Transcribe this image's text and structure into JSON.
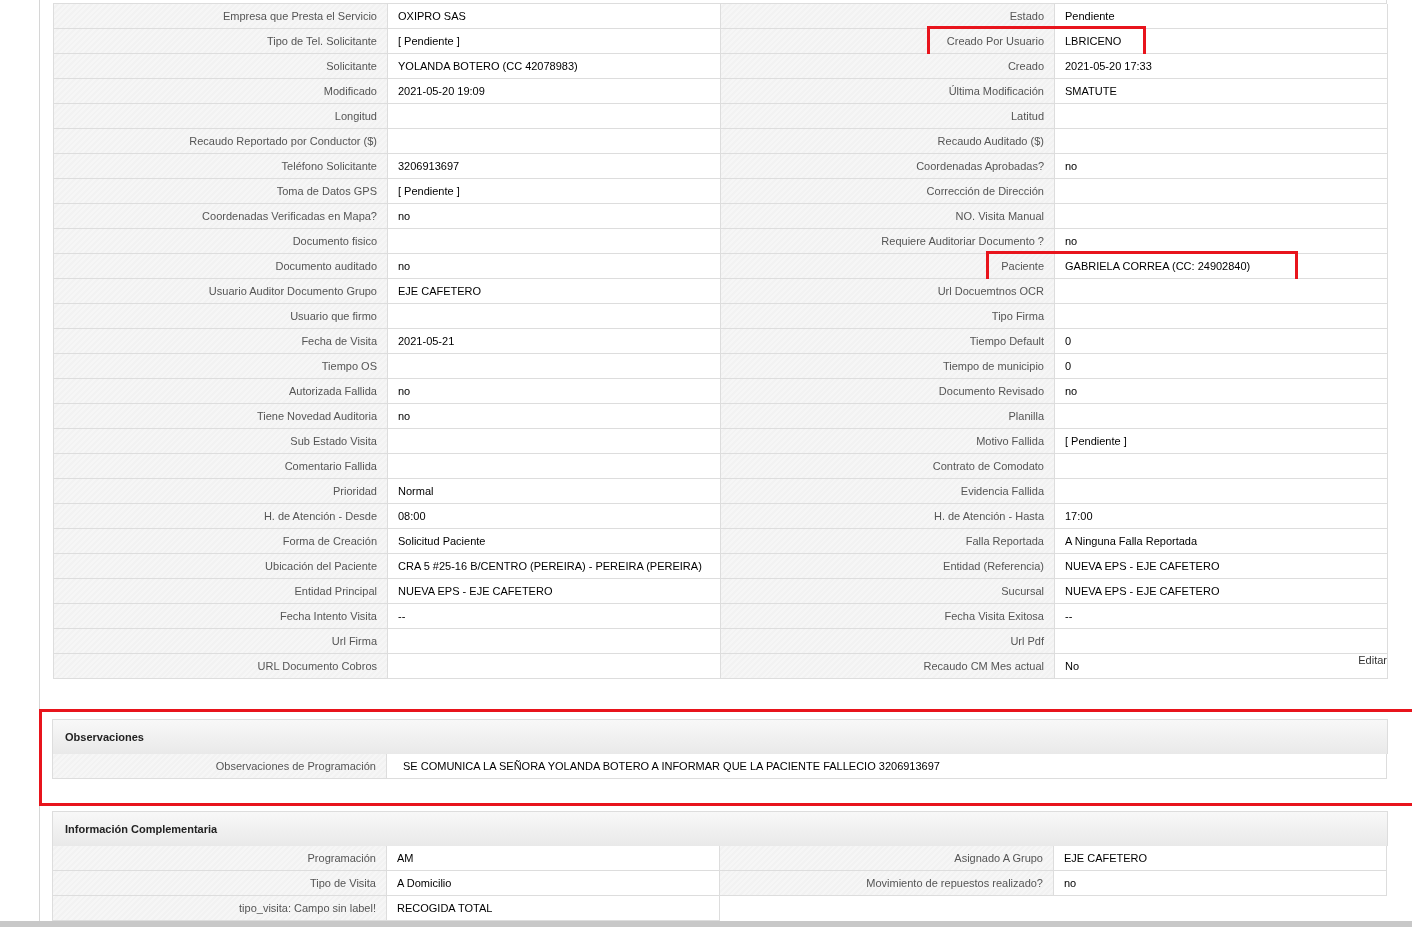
{
  "details": {
    "edit_link": "Editar",
    "rows": [
      {
        "left": {
          "label": "Empresa que Presta el Servicio",
          "value": "OXIPRO SAS"
        },
        "right": {
          "label": "Estado",
          "value": "Pendiente",
          "highlighted": false
        }
      },
      {
        "left": {
          "label": "Tipo de Tel. Solicitante",
          "value": "[ Pendiente ]"
        },
        "right": {
          "label": "Creado Por Usuario",
          "value": "LBRICENO",
          "highlighted": true
        }
      },
      {
        "left": {
          "label": "Solicitante",
          "value": "YOLANDA BOTERO (CC 42078983)"
        },
        "right": {
          "label": "Creado",
          "value": "2021-05-20 17:33",
          "highlighted": false
        }
      },
      {
        "left": {
          "label": "Modificado",
          "value": "2021-05-20 19:09"
        },
        "right": {
          "label": "Última Modificación",
          "value": "SMATUTE",
          "highlighted": false
        }
      },
      {
        "left": {
          "label": "Longitud"
        },
        "right": {
          "label": "Latitud",
          "highlighted": false
        }
      },
      {
        "left": {
          "label": "Recaudo Reportado por Conductor ($)"
        },
        "right": {
          "label": "Recaudo Auditado ($)",
          "highlighted": false
        }
      },
      {
        "left": {
          "label": "Teléfono Solicitante",
          "value": "3206913697"
        },
        "right": {
          "label": "Coordenadas Aprobadas?",
          "value": "no",
          "highlighted": false
        }
      },
      {
        "left": {
          "label": "Toma de Datos GPS",
          "value": "[ Pendiente ]"
        },
        "right": {
          "label": "Corrección de Dirección",
          "highlighted": false
        }
      },
      {
        "left": {
          "label": "Coordenadas Verificadas en Mapa?",
          "value": "no"
        },
        "right": {
          "label": "NO. Visita Manual",
          "highlighted": false
        }
      },
      {
        "left": {
          "label": "Documento fisico"
        },
        "right": {
          "label": "Requiere Auditoriar Documento ?",
          "value": "no",
          "highlighted": false
        }
      },
      {
        "left": {
          "label": "Documento auditado",
          "value": "no"
        },
        "right": {
          "label": "Paciente",
          "value": "GABRIELA CORREA (CC: 24902840)",
          "highlighted": true
        }
      },
      {
        "left": {
          "label": "Usuario Auditor Documento Grupo",
          "value": "EJE CAFETERO"
        },
        "right": {
          "label": "Url Docuemtnos OCR",
          "highlighted": false
        }
      },
      {
        "left": {
          "label": "Usuario que firmo"
        },
        "right": {
          "label": "Tipo Firma",
          "highlighted": false
        }
      },
      {
        "left": {
          "label": "Fecha de Visita",
          "value": "2021-05-21"
        },
        "right": {
          "label": "Tiempo Default",
          "value": "0",
          "highlighted": false
        }
      },
      {
        "left": {
          "label": "Tiempo OS"
        },
        "right": {
          "label": "Tiempo de municipio",
          "value": "0",
          "highlighted": false
        }
      },
      {
        "left": {
          "label": "Autorizada Fallida",
          "value": "no"
        },
        "right": {
          "label": "Documento Revisado",
          "value": "no",
          "highlighted": false
        }
      },
      {
        "left": {
          "label": "Tiene Novedad Auditoria",
          "value": "no"
        },
        "right": {
          "label": "Planilla",
          "highlighted": false
        }
      },
      {
        "left": {
          "label": "Sub Estado Visita"
        },
        "right": {
          "label": "Motivo Fallida",
          "value": "[ Pendiente ]",
          "highlighted": false
        }
      },
      {
        "left": {
          "label": "Comentario Fallida"
        },
        "right": {
          "label": "Contrato de Comodato",
          "highlighted": false
        }
      },
      {
        "left": {
          "label": "Prioridad",
          "value": "Normal"
        },
        "right": {
          "label": "Evidencia Fallida",
          "highlighted": false
        }
      },
      {
        "left": {
          "label": "H. de Atención - Desde",
          "value": "08:00"
        },
        "right": {
          "label": "H. de Atención - Hasta",
          "value": "17:00",
          "highlighted": false
        }
      },
      {
        "left": {
          "label": "Forma de Creación",
          "value": "Solicitud Paciente"
        },
        "right": {
          "label": "Falla Reportada",
          "value": "A Ninguna Falla Reportada",
          "highlighted": false
        }
      },
      {
        "left": {
          "label": "Ubicación del Paciente",
          "value": "CRA 5 #25-16 B/CENTRO (PEREIRA) - PEREIRA (PEREIRA)"
        },
        "right": {
          "label": "Entidad (Referencia)",
          "value": "NUEVA EPS - EJE CAFETERO",
          "highlighted": false
        }
      },
      {
        "left": {
          "label": "Entidad Principal",
          "value": "NUEVA EPS - EJE CAFETERO"
        },
        "right": {
          "label": "Sucursal",
          "value": "NUEVA EPS - EJE CAFETERO",
          "highlighted": false
        }
      },
      {
        "left": {
          "label": "Fecha Intento Visita",
          "value": "--"
        },
        "right": {
          "label": "Fecha Visita Exitosa",
          "value": "--",
          "highlighted": false
        }
      },
      {
        "left": {
          "label": "Url Firma"
        },
        "right": {
          "label": "Url Pdf",
          "highlighted": false
        }
      },
      {
        "left": {
          "label": "URL Documento Cobros"
        },
        "right": {
          "label": "Recaudo CM Mes actual",
          "value": "No",
          "highlighted": false
        }
      }
    ]
  },
  "observaciones": {
    "title": "Observaciones",
    "highlighted": true,
    "rows": [
      {
        "label": "Observaciones de Programación",
        "value": "SE COMUNICA LA SEÑORA YOLANDA BOTERO A INFORMAR QUE LA PACIENTE FALLECIO 3206913697"
      }
    ]
  },
  "complementaria": {
    "title": "Información Complementaria",
    "highlighted": false,
    "rows": [
      {
        "left": {
          "label": "Programación",
          "value": "AM"
        },
        "right": {
          "label": "Asignado A Grupo",
          "value": "EJE CAFETERO"
        }
      },
      {
        "left": {
          "label": "Tipo de Visita",
          "value": "A Domicilio"
        },
        "right": {
          "label": "Movimiento de repuestos realizado?",
          "value": "no"
        }
      },
      {
        "left": {
          "label": "tipo_visita: Campo sin label!",
          "value": "RECOGIDA TOTAL"
        }
      }
    ]
  }
}
